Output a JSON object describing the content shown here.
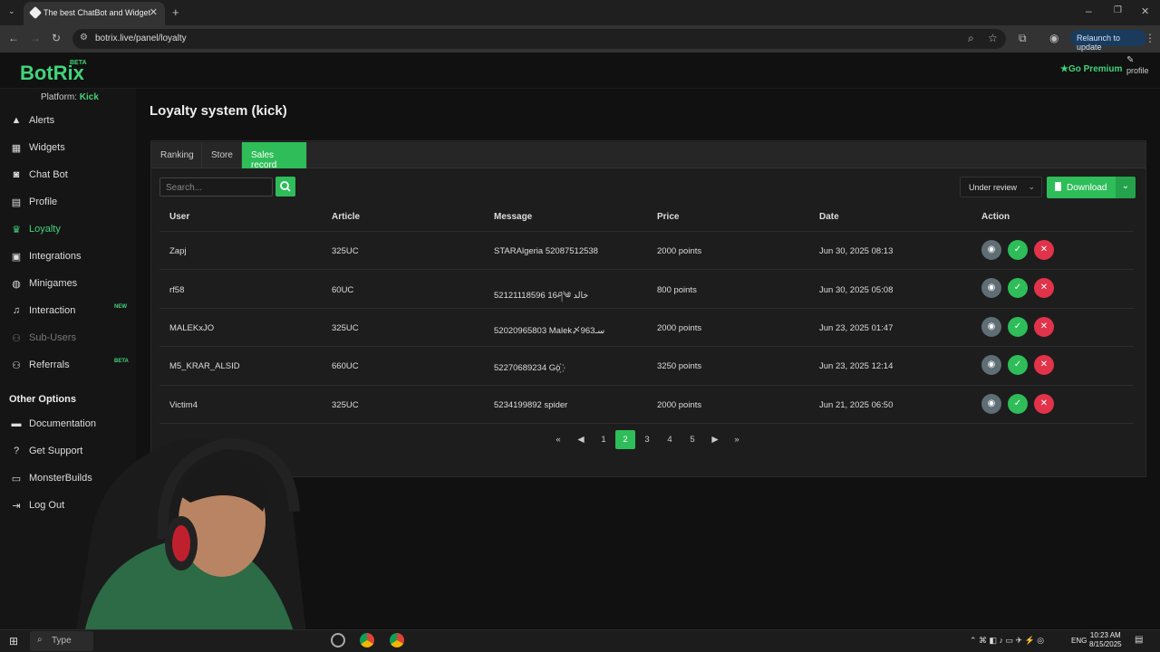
{
  "browser": {
    "tab_title": "The best ChatBot and Widgets",
    "url": "botrix.live/panel/loyalty",
    "relaunch_label": "Relaunch to update"
  },
  "header": {
    "logo": "BotRix",
    "beta": "BETA",
    "platform_label": "Platform:",
    "platform_value": "Kick",
    "premium": "Go Premium",
    "profile": "profile"
  },
  "sidebar": {
    "items": [
      {
        "label": "Alerts",
        "icon": "warning-icon"
      },
      {
        "label": "Widgets",
        "icon": "grid-icon"
      },
      {
        "label": "Chat Bot",
        "icon": "robot-icon"
      },
      {
        "label": "Profile",
        "icon": "id-card-icon"
      },
      {
        "label": "Loyalty",
        "icon": "trophy-icon"
      },
      {
        "label": "Integrations",
        "icon": "plug-icon"
      },
      {
        "label": "Minigames",
        "icon": "gamepad-icon"
      },
      {
        "label": "Interaction",
        "icon": "music-icon",
        "tag": "NEW"
      },
      {
        "label": "Sub-Users",
        "icon": "users-icon"
      },
      {
        "label": "Referrals",
        "icon": "users-icon",
        "tag": "BETA"
      }
    ],
    "other_heading": "Other Options",
    "other_items": [
      {
        "label": "Documentation",
        "icon": "book-icon"
      },
      {
        "label": "Get Support",
        "icon": "question-icon"
      },
      {
        "label": "MonsterBuilds",
        "icon": "monitor-icon"
      },
      {
        "label": "Log Out",
        "icon": "logout-icon"
      }
    ]
  },
  "main": {
    "title": "Loyalty system (kick)",
    "tabs": [
      "Ranking",
      "Store",
      "Sales record"
    ],
    "search_placeholder": "Search...",
    "filter_value": "Under review",
    "download_label": "Download",
    "columns": [
      "User",
      "Article",
      "Message",
      "Price",
      "Date",
      "Action"
    ],
    "rows": [
      {
        "user": "Zapj",
        "article": "325UC",
        "message": "STARAlgeria 52087512538",
        "price": "2000 points",
        "date": "Jun 30, 2025 08:13"
      },
      {
        "user": "rf58",
        "article": "60UC",
        "message": "52121118596 16ཤ༄ ﺧﺎﻟﺪ",
        "price": "800 points",
        "date": "Jun 30, 2025 05:08"
      },
      {
        "user": "MALEKxJO",
        "article": "325UC",
        "message": "52020965803 Malek〆963ﺳـ",
        "price": "2000 points",
        "date": "Jun 23, 2025 01:47"
      },
      {
        "user": "M5_KRAR_ALSID",
        "article": "660UC",
        "message": "52270689234 Go꙰",
        "price": "3250 points",
        "date": "Jun 23, 2025 12:14"
      },
      {
        "user": "Victim4",
        "article": "325UC",
        "message": "5234199892 spider",
        "price": "2000 points",
        "date": "Jun 21, 2025 06:50"
      }
    ],
    "pagination": [
      "1",
      "2",
      "3",
      "4",
      "5"
    ],
    "current_page": "2"
  },
  "taskbar": {
    "search": "Type",
    "lang": "ENG",
    "time": "10:23 AM",
    "date": "8/15/2025"
  },
  "colors": {
    "accent": "#2ebd59",
    "danger": "#e2334a",
    "view": "#5f6d75"
  }
}
